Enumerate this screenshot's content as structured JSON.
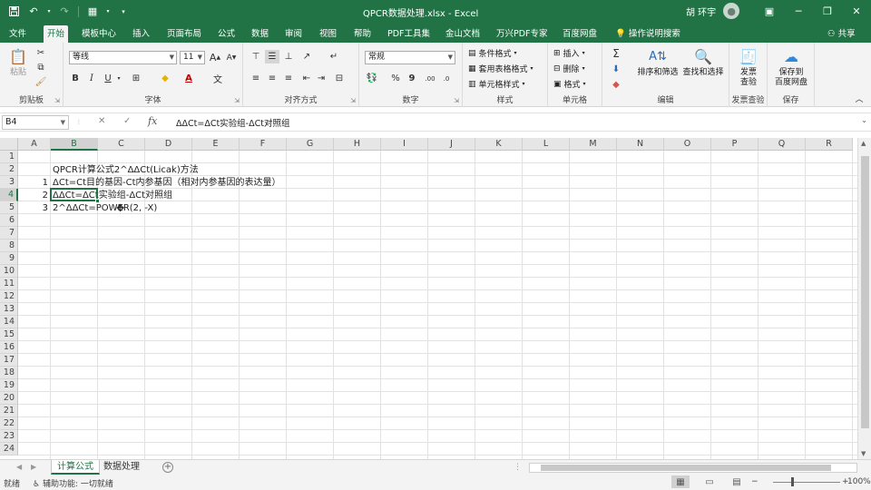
{
  "window": {
    "title": "QPCR数据处理.xlsx  -  Excel",
    "user": "胡 环宇"
  },
  "qat": {
    "save_icon": "save-icon",
    "undo_icon": "undo-icon",
    "redo_icon": "redo-icon",
    "customize_icon": "customize-icon"
  },
  "window_controls": {
    "ribbon_display": "▣",
    "minimize": "─",
    "restore": "❐",
    "close": "✕"
  },
  "tabs": [
    "文件",
    "开始",
    "模板中心",
    "插入",
    "页面布局",
    "公式",
    "数据",
    "审阅",
    "视图",
    "帮助",
    "PDF工具集",
    "金山文档",
    "万兴PDF专家",
    "百度网盘"
  ],
  "active_tab": "开始",
  "tell_me": "操作说明搜索",
  "share": "共享",
  "ribbon": {
    "clipboard": {
      "label": "剪贴板",
      "paste": "粘贴"
    },
    "font": {
      "label": "字体",
      "name": "等线",
      "size": "11",
      "bold": "B",
      "italic": "I",
      "underline": "U",
      "grow": "A",
      "shrink": "A"
    },
    "alignment": {
      "label": "对齐方式"
    },
    "number": {
      "label": "数字",
      "format": "常规",
      "percent": "%",
      "comma": "9"
    },
    "styles": {
      "label": "样式",
      "conditional": "条件格式",
      "table": "套用表格格式",
      "cell": "单元格样式"
    },
    "cells": {
      "label": "单元格",
      "insert": "插入",
      "delete": "删除",
      "format": "格式"
    },
    "editing": {
      "label": "编辑",
      "sort": "排序和筛选",
      "find": "查找和选择"
    },
    "invoice": {
      "label": "发票查验",
      "btn_line1": "发票",
      "btn_line2": "查验"
    },
    "save": {
      "label": "保存",
      "btn_line1": "保存到",
      "btn_line2": "百度网盘"
    }
  },
  "formula_bar": {
    "name_box": "B4",
    "formula": "ΔΔCt=ΔCt实验组-ΔCt对照组"
  },
  "columns": [
    "A",
    "B",
    "C",
    "D",
    "E",
    "F",
    "G",
    "H",
    "I",
    "J",
    "K",
    "L",
    "M",
    "N",
    "O",
    "P",
    "Q",
    "R"
  ],
  "rows": [
    "1",
    "2",
    "3",
    "4",
    "5",
    "6",
    "7",
    "8",
    "9",
    "10",
    "11",
    "12",
    "13",
    "14",
    "15",
    "16",
    "17",
    "18",
    "19",
    "20",
    "21",
    "22",
    "23",
    "24"
  ],
  "cells": {
    "B2": "QPCR计算公式2^ΔΔCt(Licak)方法",
    "A3": "1",
    "B3": "ΔCt=Ct目的基因-Ct内参基因（相对内参基因的表达量）",
    "A4": "2",
    "B4": "ΔΔCt=ΔCt实验组-ΔCt对照组",
    "A5": "3",
    "B5": "2^ΔΔCt=POWER(2, -X)"
  },
  "sheets": [
    "计算公式",
    "数据处理"
  ],
  "active_sheet": "计算公式",
  "status": {
    "mode": "就绪",
    "accessibility": "辅助功能: 一切就绪",
    "zoom": "100%"
  }
}
